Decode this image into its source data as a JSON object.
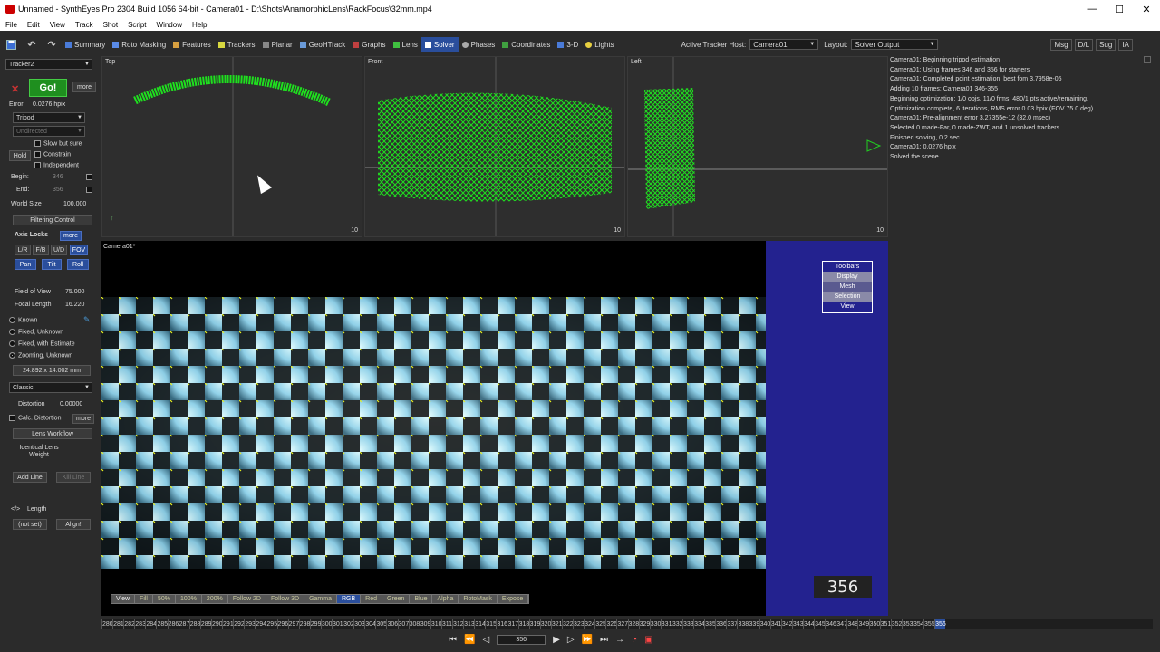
{
  "title": "Unnamed - SynthEyes Pro 2304 Build 1056 64-bit - Camera01 - D:\\Shots\\AnamorphicLens\\RackFocus\\32mm.mp4",
  "window_controls": {
    "minimize": "—",
    "maximize": "☐",
    "close": "✕"
  },
  "menu": [
    "File",
    "Edit",
    "View",
    "Track",
    "Shot",
    "Script",
    "Window",
    "Help"
  ],
  "toolbar": {
    "rooms": [
      {
        "label": "Summary",
        "icon": "summary-icon"
      },
      {
        "label": "Roto Masking",
        "icon": "roto-icon"
      },
      {
        "label": "Features",
        "icon": "features-icon"
      },
      {
        "label": "Trackers",
        "icon": "trackers-icon"
      },
      {
        "label": "Planar",
        "icon": "planar-icon"
      },
      {
        "label": "GeoHTrack",
        "icon": "geohtrack-icon"
      },
      {
        "label": "Graphs",
        "icon": "graphs-icon"
      },
      {
        "label": "Lens",
        "icon": "lens-icon"
      },
      {
        "label": "Solver",
        "icon": "solver-icon",
        "active": true
      },
      {
        "label": "Phases",
        "icon": "phases-icon"
      },
      {
        "label": "Coordinates",
        "icon": "coordinates-icon"
      },
      {
        "label": "3-D",
        "icon": "3d-icon"
      },
      {
        "label": "Lights",
        "icon": "lights-icon"
      }
    ],
    "active_tracker_host_label": "Active Tracker Host:",
    "active_tracker_host_value": "Camera01",
    "layout_label": "Layout:",
    "layout_value": "Solver Output",
    "right_buttons": [
      "Msg",
      "D/L",
      "Sug",
      "IA"
    ]
  },
  "left_panel": {
    "tracker_select": "Tracker2",
    "go_label": "Go!",
    "more_label": "more",
    "error_label": "Error:",
    "error_value": "0.0276 hpix",
    "mode_select": "Tripod",
    "direction_select": "Undirected",
    "slow_but_sure": "Slow but sure",
    "hold_label": "Hold",
    "constrain": "Constrain",
    "independent": "Independent",
    "begin_label": "Begin:",
    "begin_value": "346",
    "end_label": "End:",
    "end_value": "356",
    "world_size_label": "World Size",
    "world_size_value": "100.000",
    "filtering_control": "Filtering Control",
    "axis_locks_label": "Axis Locks",
    "axis_more": "more",
    "axis_row1": [
      "L/R",
      "F/B",
      "U/D",
      "FOV"
    ],
    "axis_row2": [
      "Pan",
      "Tilt",
      "Roll"
    ],
    "fov_label": "Field of View",
    "fov_value": "75.000",
    "focal_label": "Focal Length",
    "focal_value": "16.220",
    "lens_modes": [
      "Known",
      "Fixed, Unknown",
      "Fixed, with Estimate",
      "Zooming, Unknown"
    ],
    "lens_mode_selected": 3,
    "back_size": "24.892 x 14.002 mm",
    "lens_model": "Classic",
    "distortion_label": "Distortion",
    "distortion_value": "0.00000",
    "calc_distortion": "Calc. Distortion",
    "calc_more": "more",
    "lens_workflow": "Lens Workflow",
    "identical_lens_weight": "Identical Lens Weight",
    "add_line": "Add Line",
    "kill_line": "Kill Line",
    "length_label": "Length",
    "not_set": "(not set)",
    "align": "Align!"
  },
  "viewports": {
    "top_label": "Top",
    "front_label": "Front",
    "left_label": "Left",
    "corner_number": "10",
    "camera_label": "Camera01*"
  },
  "overlay_menu": [
    "Toolbars",
    "Display",
    "Mesh",
    "Selection",
    "View"
  ],
  "frame_number": "356",
  "view_bar": [
    "View",
    "Fill",
    "50%",
    "100%",
    "200%",
    "Follow 2D",
    "Follow 3D",
    "Gamma",
    "RGB",
    "Red",
    "Green",
    "Blue",
    "Alpha",
    "RotoMask",
    "Expose"
  ],
  "solver_log": [
    "Camera01: Beginning tripod estimation",
    "Camera01: Using frames 346 and 356 for starters",
    "Camera01: Completed point estimation, best fom 3.7958e-05",
    "Adding 10 frames: Camera01 346-355",
    "Beginning optimization: 1/0 objs, 11/0 frms, 480/1 pts active/remaining.",
    "Optimization complete, 6 iterations, RMS error 0.03 hpix (FOV 75.0 deg)",
    "Camera01: Pre-alignment error 3.27355e-12 (32.0 msec)",
    "Selected 0 made-Far, 0 made-ZWT, and 1 unsolved trackers.",
    "Finished solving, 0.2 sec.",
    "Camera01: 0.0276 hpix",
    "Solved the scene."
  ],
  "timeline": {
    "start": 280,
    "end": 356,
    "current": "356"
  },
  "transport": {
    "frame_value": "356"
  },
  "colors": {
    "accent": "#2a4e9c",
    "tracker": "#22dd22",
    "go": "#1f8f1f",
    "overlay": "#23228f"
  }
}
